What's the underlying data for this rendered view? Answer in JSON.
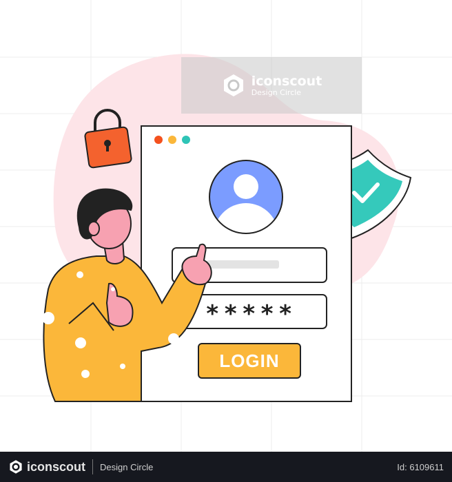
{
  "watermark": {
    "brand": "iconscout",
    "subtitle": "Design Circle"
  },
  "login_form": {
    "password_mask": "*****",
    "login_label": "LOGIN"
  },
  "footer": {
    "brand": "iconscout",
    "author": "Design Circle",
    "id_label": "Id: 6109611"
  },
  "colors": {
    "window_dots": [
      "#f4511e",
      "#fbb73a",
      "#2ec4b6"
    ],
    "avatar": "#7b9cff",
    "shield": "#35c9bb",
    "lock": "#f4622e",
    "button": "#fbb73a",
    "shirt": "#fbb73a",
    "skin": "#f7a1b1",
    "blob": "#fde4e8"
  }
}
